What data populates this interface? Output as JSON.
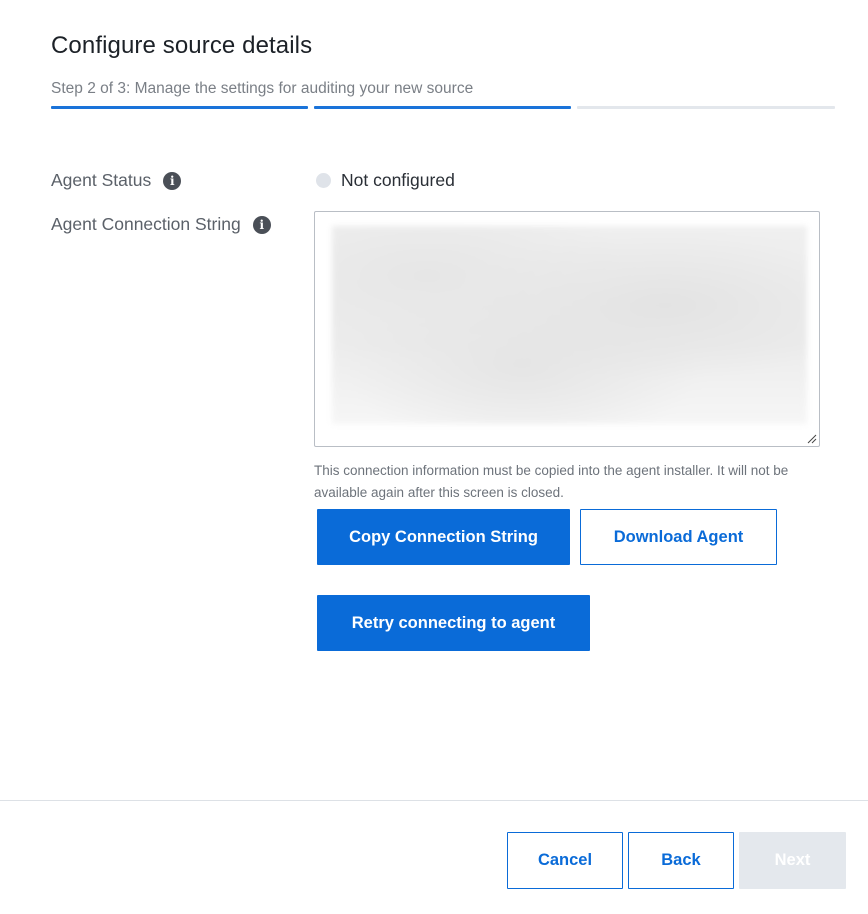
{
  "header": {
    "title": "Configure source details",
    "subtitle": "Step 2 of 3: Manage the settings for auditing your new source",
    "steps": [
      {
        "state": "complete"
      },
      {
        "state": "current"
      },
      {
        "state": "upcoming"
      }
    ]
  },
  "form": {
    "agent_status": {
      "label": "Agent Status",
      "value": "Not configured",
      "icon": "info-icon"
    },
    "connection_string": {
      "label": "Agent Connection String",
      "icon": "info-icon",
      "value_obscured": true
    },
    "help_text": "This connection information must be copied into the agent installer. It will not be available again after this screen is closed.",
    "copy_button_label": "Copy Connection String",
    "download_button_label": "Download Agent",
    "retry_button_label": "Retry connecting to agent"
  },
  "footer": {
    "cancel_label": "Cancel",
    "back_label": "Back",
    "next_label": "Next"
  },
  "colors": {
    "accent": "#0a6bd8",
    "progress_active": "#1a73d9",
    "progress_inactive": "#e3e7ec",
    "disabled_button": "#e4e8ed",
    "status_dot": "#dfe3e9"
  }
}
